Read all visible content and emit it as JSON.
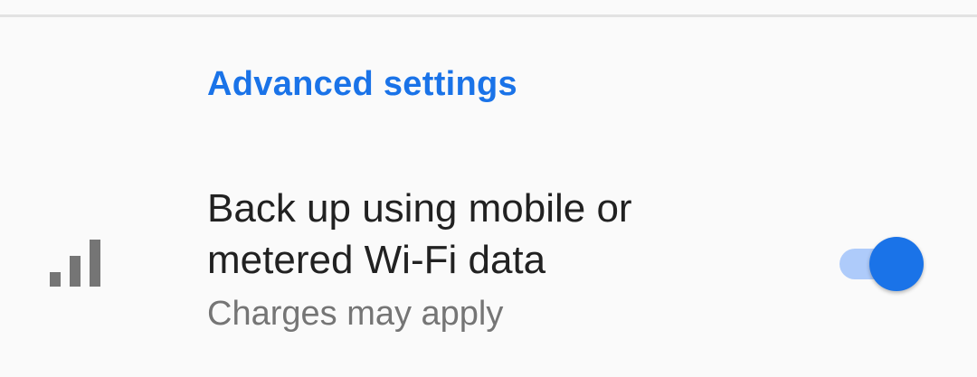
{
  "section": {
    "header": "Advanced settings"
  },
  "setting": {
    "title": "Back up using mobile or metered Wi-Fi data",
    "summary": "Charges may apply",
    "icon": "cellular-signal-icon",
    "toggle_on": true
  },
  "colors": {
    "accent": "#1a73e8",
    "track": "#aecbfa",
    "icon": "#757575"
  }
}
